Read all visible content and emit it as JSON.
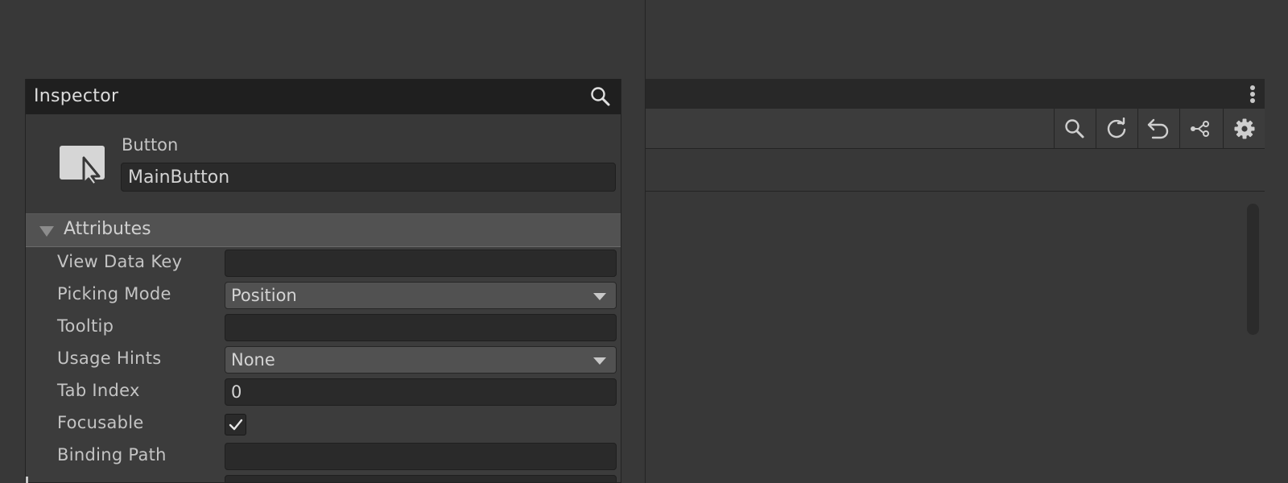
{
  "inspector": {
    "title": "Inspector",
    "element": {
      "type": "Button",
      "name": "MainButton"
    },
    "attributes": {
      "label": "Attributes",
      "expanded": true,
      "rows": {
        "view_data_key": {
          "label": "View Data Key",
          "value": ""
        },
        "picking_mode": {
          "label": "Picking Mode",
          "value": "Position"
        },
        "tooltip": {
          "label": "Tooltip",
          "value": ""
        },
        "usage_hints": {
          "label": "Usage Hints",
          "value": "None"
        },
        "tab_index": {
          "label": "Tab Index",
          "value": "0"
        },
        "focusable": {
          "label": "Focusable",
          "checked": true
        },
        "binding_path": {
          "label": "Binding Path",
          "value": ""
        }
      }
    }
  },
  "toolbar": {
    "icons": [
      "search-icon",
      "refresh-icon",
      "undo-icon",
      "branch-icon",
      "gear-icon"
    ]
  },
  "colors": {
    "background": "#383838",
    "title_bar": "#1f1f1f",
    "field_bg": "#2a2a2a",
    "dropdown_bg": "#515151",
    "section_header": "#525252"
  }
}
